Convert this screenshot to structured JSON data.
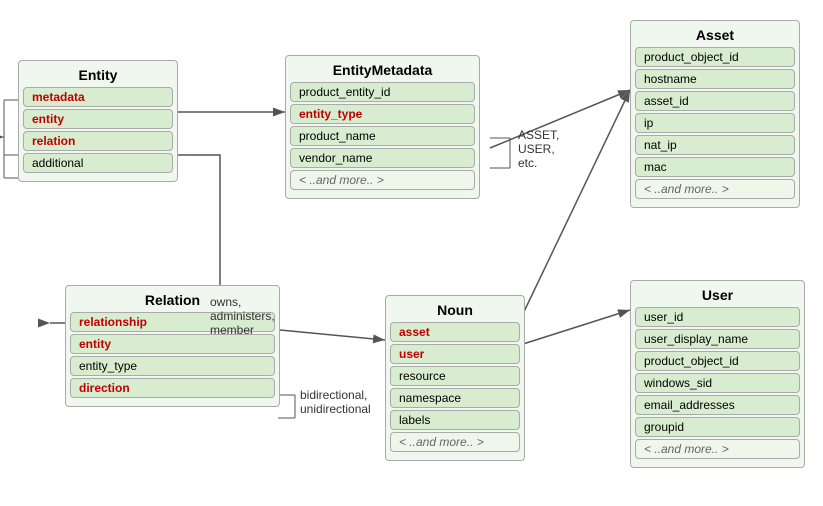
{
  "entity": {
    "title": "Entity",
    "fields": [
      {
        "label": "metadata",
        "style": "bold"
      },
      {
        "label": "entity",
        "style": "bold"
      },
      {
        "label": "relation",
        "style": "bold"
      },
      {
        "label": "additional",
        "style": "normal"
      }
    ]
  },
  "entityMetadata": {
    "title": "EntityMetadata",
    "fields": [
      {
        "label": "product_entity_id",
        "style": "normal"
      },
      {
        "label": "entity_type",
        "style": "bold"
      },
      {
        "label": "product_name",
        "style": "normal"
      },
      {
        "label": "vendor_name",
        "style": "normal"
      },
      {
        "label": "< ..and more.. >",
        "style": "italic"
      }
    ]
  },
  "asset": {
    "title": "Asset",
    "fields": [
      {
        "label": "product_object_id",
        "style": "normal"
      },
      {
        "label": "hostname",
        "style": "normal"
      },
      {
        "label": "asset_id",
        "style": "normal"
      },
      {
        "label": "ip",
        "style": "normal"
      },
      {
        "label": "nat_ip",
        "style": "normal"
      },
      {
        "label": "mac",
        "style": "normal"
      },
      {
        "label": "< ..and more.. >",
        "style": "italic"
      }
    ]
  },
  "relation": {
    "title": "Relation",
    "fields": [
      {
        "label": "relationship",
        "style": "bold"
      },
      {
        "label": "entity",
        "style": "bold"
      },
      {
        "label": "entity_type",
        "style": "normal"
      },
      {
        "label": "direction",
        "style": "bold"
      }
    ]
  },
  "noun": {
    "title": "Noun",
    "fields": [
      {
        "label": "asset",
        "style": "bold"
      },
      {
        "label": "user",
        "style": "bold"
      },
      {
        "label": "resource",
        "style": "normal"
      },
      {
        "label": "namespace",
        "style": "normal"
      },
      {
        "label": "labels",
        "style": "normal"
      },
      {
        "label": "< ..and more.. >",
        "style": "italic"
      }
    ]
  },
  "user": {
    "title": "User",
    "fields": [
      {
        "label": "user_id",
        "style": "normal"
      },
      {
        "label": "user_display_name",
        "style": "normal"
      },
      {
        "label": "product_object_id",
        "style": "normal"
      },
      {
        "label": "windows_sid",
        "style": "normal"
      },
      {
        "label": "email_addresses",
        "style": "normal"
      },
      {
        "label": "groupid",
        "style": "normal"
      },
      {
        "label": "< ..and more.. >",
        "style": "italic"
      }
    ]
  },
  "annotations": {
    "entityType": "ASSET,\nUSER,\netc.",
    "owns": "owns,\nadministers,\nmember",
    "bidirectional": "bidirectional,\nunidirectional",
    "andMore": "and more"
  }
}
